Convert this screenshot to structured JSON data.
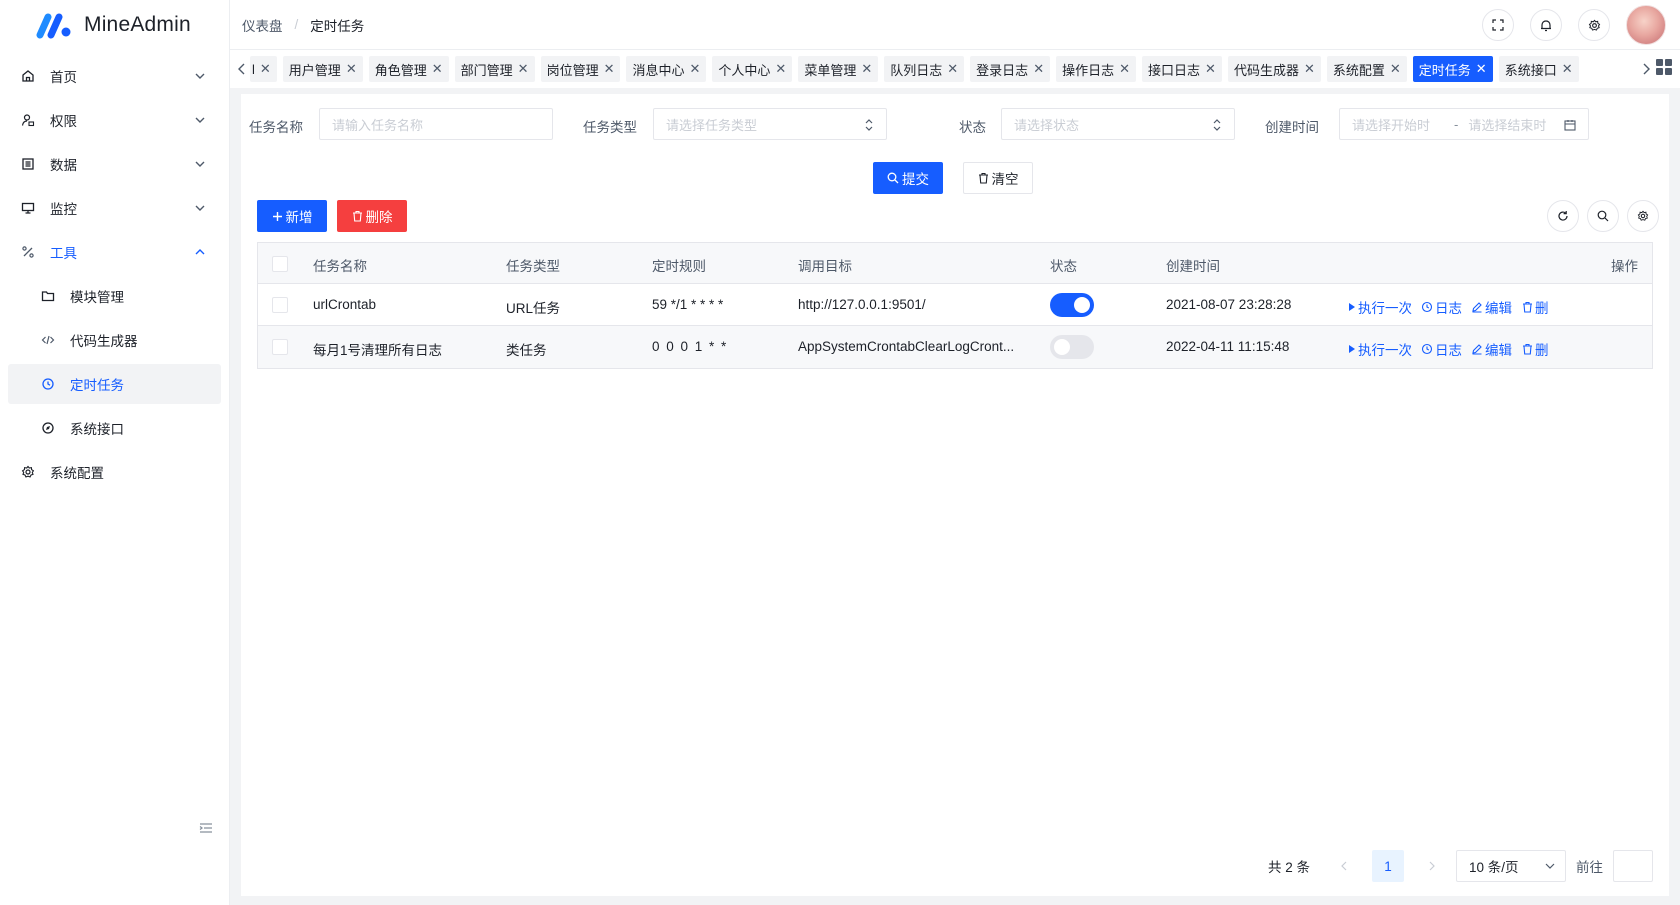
{
  "app": {
    "name": "MineAdmin"
  },
  "colors": {
    "primary": "#165dff",
    "danger": "#f53f3f"
  },
  "sidebar": {
    "items": [
      {
        "label": "首页",
        "icon": "home-icon"
      },
      {
        "label": "权限",
        "icon": "user-lock-icon"
      },
      {
        "label": "数据",
        "icon": "list-icon"
      },
      {
        "label": "监控",
        "icon": "desktop-icon"
      },
      {
        "label": "工具",
        "icon": "tools-icon"
      },
      {
        "label": "模块管理",
        "icon": "folder-icon"
      },
      {
        "label": "代码生成器",
        "icon": "code-icon"
      },
      {
        "label": "定时任务",
        "icon": "clock-icon"
      },
      {
        "label": "系统接口",
        "icon": "compass-icon"
      },
      {
        "label": "系统配置",
        "icon": "gear-icon"
      }
    ]
  },
  "breadcrumb": {
    "root": "仪表盘",
    "current": "定时任务"
  },
  "tabs": [
    {
      "label": "l"
    },
    {
      "label": "用户管理"
    },
    {
      "label": "角色管理"
    },
    {
      "label": "部门管理"
    },
    {
      "label": "岗位管理"
    },
    {
      "label": "消息中心"
    },
    {
      "label": "个人中心"
    },
    {
      "label": "菜单管理"
    },
    {
      "label": "队列日志"
    },
    {
      "label": "登录日志"
    },
    {
      "label": "操作日志"
    },
    {
      "label": "接口日志"
    },
    {
      "label": "代码生成器"
    },
    {
      "label": "系统配置"
    },
    {
      "label": "定时任务"
    },
    {
      "label": "系统接口"
    }
  ],
  "search": {
    "name_label": "任务名称",
    "name_placeholder": "请输入任务名称",
    "type_label": "任务类型",
    "type_placeholder": "请选择任务类型",
    "status_label": "状态",
    "status_placeholder": "请选择状态",
    "time_label": "创建时间",
    "time_start_placeholder": "请选择开始时",
    "time_sep": "-",
    "time_end_placeholder": "请选择结束时",
    "submit": "提交",
    "reset": "清空"
  },
  "toolbar": {
    "add": "新增",
    "delete": "删除"
  },
  "table": {
    "columns": [
      "任务名称",
      "任务类型",
      "定时规则",
      "调用目标",
      "状态",
      "创建时间",
      "操作"
    ],
    "rows": [
      {
        "name": "urlCrontab",
        "type": "URL任务",
        "rule": "59 */1 * * * *",
        "target": "http://127.0.0.1:9501/",
        "status": true,
        "created": "2021-08-07 23:28:28"
      },
      {
        "name": "每月1号清理所有日志",
        "type": "类任务",
        "rule": "0 0 0 1 * *",
        "target": "AppSystemCrontabClearLogCront...",
        "status": false,
        "created": "2022-04-11 11:15:48"
      }
    ],
    "actions": {
      "run": "执行一次",
      "log": "日志",
      "edit": "编辑",
      "delete": "删"
    }
  },
  "pagination": {
    "total": "共 2 条",
    "current": "1",
    "size": "10 条/页",
    "goto": "前往"
  }
}
